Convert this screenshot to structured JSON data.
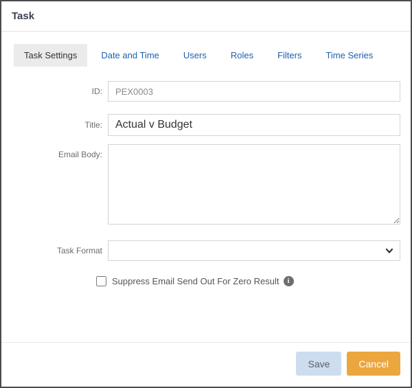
{
  "dialog": {
    "title": "Task"
  },
  "tabs": [
    {
      "label": "Task Settings",
      "active": true
    },
    {
      "label": "Date and Time",
      "active": false
    },
    {
      "label": "Users",
      "active": false
    },
    {
      "label": "Roles",
      "active": false
    },
    {
      "label": "Filters",
      "active": false
    },
    {
      "label": "Time Series",
      "active": false
    }
  ],
  "form": {
    "id": {
      "label": "ID:",
      "value": "PEX0003"
    },
    "title": {
      "label": "Title:",
      "value": "Actual v Budget"
    },
    "email_body": {
      "label": "Email Body:",
      "value": ""
    },
    "task_format": {
      "label": "Task Format",
      "value": ""
    },
    "suppress": {
      "label": "Suppress Email Send Out For Zero Result",
      "checked": false
    }
  },
  "icons": {
    "info": "i",
    "chevron_down": "chevron-down"
  },
  "footer": {
    "save_label": "Save",
    "cancel_label": "Cancel"
  },
  "colors": {
    "tab_link": "#1d5fad",
    "active_tab_bg": "#ebebeb",
    "save_bg": "#cdddf0",
    "cancel_bg": "#eca63e",
    "dialog_border": "#4b4b4b"
  }
}
